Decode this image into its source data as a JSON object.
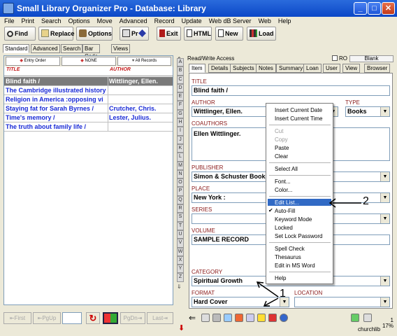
{
  "window": {
    "title": "Small Library Organizer Pro - Database: Library"
  },
  "menu": [
    "File",
    "Print",
    "Search",
    "Options",
    "Move",
    "Advanced",
    "Record",
    "Update",
    "Web dB Server",
    "Web",
    "Help"
  ],
  "toolbar": {
    "find": "Find",
    "replace": "Replace",
    "options": "Options",
    "print": "Pr",
    "exit": "Exit",
    "html": "HTML",
    "new": "New",
    "load": "Load"
  },
  "mode_tabs": [
    "Standard",
    "Advanced",
    "Search",
    "Bar Code",
    "Views"
  ],
  "list": {
    "sort_buttons": [
      "Entry Order",
      "NONE",
      "All Records"
    ],
    "col_title": "TITLE",
    "col_author": "AUTHOR",
    "rows": [
      {
        "title": "Blind faith /",
        "author": "Wittlinger, Ellen."
      },
      {
        "title": "The Cambridge illustrated history",
        "author": ""
      },
      {
        "title": "Religion in America :opposing vi",
        "author": ""
      },
      {
        "title": "Staying fat for Sarah Byrnes /",
        "author": "Crutcher, Chris."
      },
      {
        "title": "Time's memory /",
        "author": "Lester, Julius."
      },
      {
        "title": "The truth about family life /",
        "author": ""
      }
    ]
  },
  "nav": {
    "first": "First",
    "pgup": "PgUp",
    "pgdn": "PgDn",
    "last": "Last"
  },
  "letters": [
    "A",
    "B",
    "C",
    "D",
    "E",
    "F",
    "G",
    "H",
    "I",
    "J",
    "K",
    "L",
    "M",
    "N",
    "O",
    "P",
    "Q",
    "R",
    "S",
    "T",
    "U",
    "V",
    "W",
    "X",
    "Y",
    "Z"
  ],
  "panel": {
    "rw": "Read/Write Access",
    "ro": "RO",
    "blank": "Blank"
  },
  "item_tabs": [
    "Item",
    "Details",
    "Subjects",
    "Notes",
    "Summary",
    "Loan",
    "User",
    "View",
    "Browser"
  ],
  "form": {
    "title_label": "TITLE",
    "title": "Blind faith /",
    "author_label": "AUTHOR",
    "author": "Wittlinger, Ellen.",
    "type_label": "TYPE",
    "type": "Books",
    "coauthors_label": "COAUTHORS",
    "coauthors": "Ellen Wittlinger.",
    "publisher_label": "PUBLISHER",
    "publisher": "Simon & Schuster Book",
    "place_label": "PLACE",
    "place": "New York :",
    "series_label": "SERIES",
    "series": "",
    "volume_label": "VOLUME",
    "volume": "SAMPLE RECORD",
    "category_label": "CATEGORY",
    "category": "Spiritual Growth",
    "format_label": "FORMAT",
    "format": "Hard Cover",
    "location_label": "LOCATION",
    "location": ""
  },
  "context_menu": {
    "insert_date": "Insert Current Date",
    "insert_time": "Insert Current Time",
    "cut": "Cut",
    "copy": "Copy",
    "paste": "Paste",
    "clear": "Clear",
    "select_all": "Select All",
    "font": "Font...",
    "color": "Color...",
    "edit_list": "Edit List...",
    "auto_fill": "Auto-Fill",
    "keyword_mode": "Keyword Mode",
    "locked": "Locked",
    "set_lock_password": "Set Lock Password",
    "spell_check": "Spell Check",
    "thesaurus": "Thesaurus",
    "edit_in_ms_word": "Edit in MS Word",
    "help": "Help"
  },
  "annotations": {
    "one": "1",
    "two": "2"
  },
  "status": {
    "user": "churchlib",
    "page": "1",
    "percent": "17%"
  },
  "colors": {
    "title_bar": "#0b47c7",
    "list_text": "#1a2bd6",
    "field_label": "#8a1a1a",
    "menu_highlight": "#316ac5"
  }
}
